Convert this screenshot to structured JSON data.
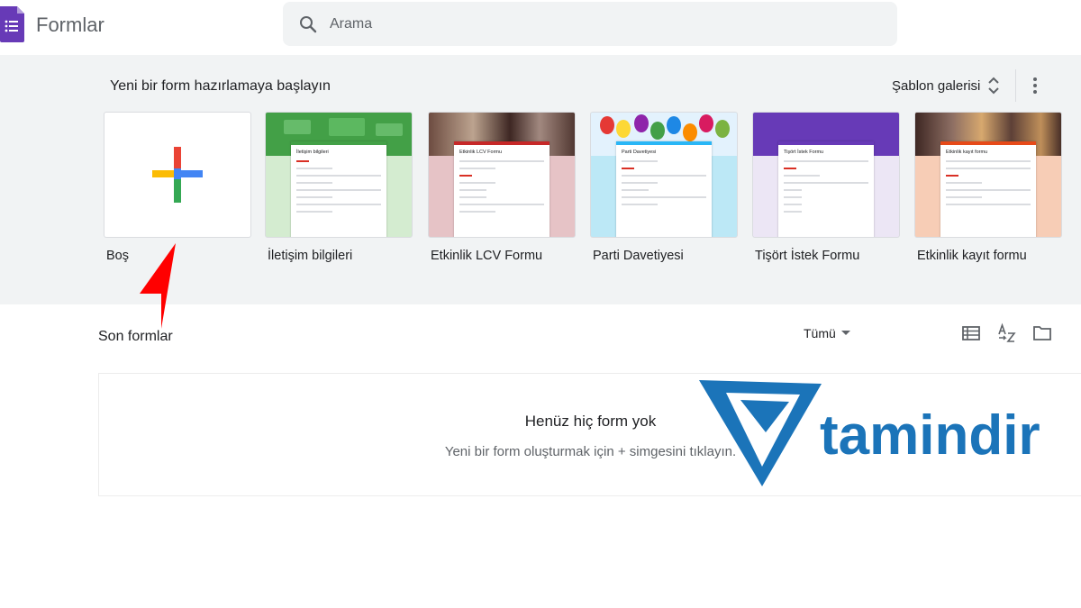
{
  "header": {
    "app_title": "Formlar",
    "search_placeholder": "Arama",
    "brand_color": "#673ab7"
  },
  "templates_band": {
    "title": "Yeni bir form hazırlamaya başlayın",
    "gallery_label": "Şablon galerisi",
    "items": [
      {
        "label": "Boş"
      },
      {
        "label": "İletişim bilgileri",
        "form_title": "İletişim bilgileri",
        "accent": "#43a047"
      },
      {
        "label": "Etkinlik LCV Formu",
        "form_title": "Etkinlik LCV Formu",
        "accent": "#c62828"
      },
      {
        "label": "Parti Davetiyesi",
        "form_title": "Parti Davetiyesi",
        "accent": "#29b6f6"
      },
      {
        "label": "Tişört İstek Formu",
        "form_title": "Tişört İstek Formu",
        "accent": "#673ab7"
      },
      {
        "label": "Etkinlik kayıt formu",
        "form_title": "Etkinlik kayıt formu",
        "accent": "#e64a19"
      }
    ]
  },
  "recent": {
    "title": "Son formlar",
    "filter_label": "Tümü",
    "empty_title": "Henüz hiç form yok",
    "empty_subtitle": "Yeni bir form oluşturmak için + simgesini tıklayın."
  },
  "watermark": {
    "text": "tamindir",
    "color": "#1b74b9"
  },
  "annotation": {
    "arrow_color": "#ff0000"
  }
}
